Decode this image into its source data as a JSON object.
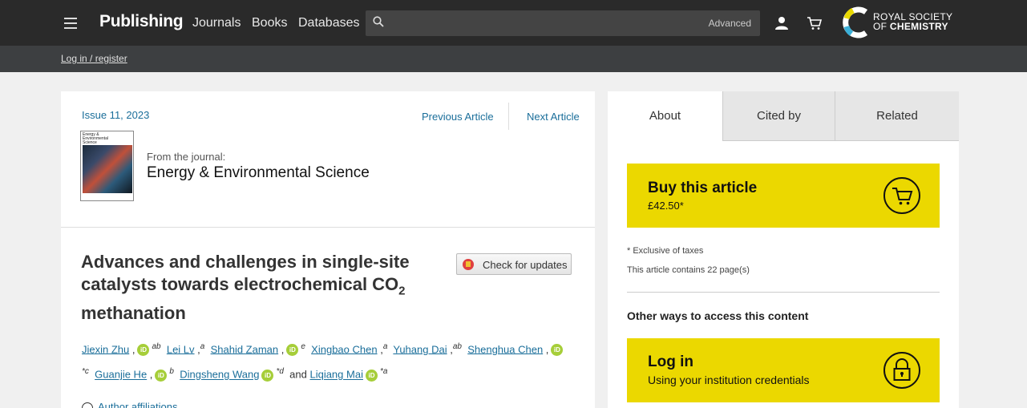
{
  "header": {
    "brand": "Publishing",
    "nav": [
      "Journals",
      "Books",
      "Databases"
    ],
    "search_placeholder": "",
    "advanced_label": "Advanced",
    "logo_line1": "ROYAL SOCIETY",
    "logo_line2_prefix": "OF",
    "logo_line2_bold": "CHEMISTRY"
  },
  "subbar": {
    "login_label": "Log in / register"
  },
  "article_nav": {
    "issue": "Issue 11, 2023",
    "previous": "Previous Article",
    "next": "Next Article"
  },
  "journal": {
    "from_label": "From the journal:",
    "name": "Energy & Environmental Science",
    "cover_title": "Energy & Environmental Science"
  },
  "article": {
    "title_main": "Advances and challenges in single-site catalysts towards electrochemical CO",
    "title_sub": "2",
    "title_end": " methanation",
    "check_updates": "Check for updates",
    "affiliations": "Author affiliations"
  },
  "authors": [
    {
      "name": "Jiexin Zhu",
      "orcid": true,
      "star": "",
      "sup": "ab"
    },
    {
      "name": "Lei Lv",
      "orcid": false,
      "star": "",
      "sup": "a"
    },
    {
      "name": "Shahid Zaman",
      "orcid": true,
      "star": "",
      "sup": "e"
    },
    {
      "name": "Xingbao Chen",
      "orcid": false,
      "star": "",
      "sup": "a"
    },
    {
      "name": "Yuhang Dai",
      "orcid": false,
      "star": "",
      "sup": "ab"
    },
    {
      "name": "Shenghua Chen",
      "orcid": true,
      "star": "*",
      "sup": "c"
    },
    {
      "name": "Guanjie He",
      "orcid": true,
      "star": "",
      "sup": "b"
    },
    {
      "name": "Dingsheng Wang",
      "orcid": true,
      "star": "*",
      "sup": "d"
    },
    {
      "name": "Liqiang Mai",
      "orcid": true,
      "star": "*",
      "sup": "a"
    }
  ],
  "authors_and": "and",
  "orcid_label": "iD",
  "sidebar": {
    "tabs": [
      "About",
      "Cited by",
      "Related"
    ],
    "buy_title": "Buy this article",
    "buy_price": "£42.50*",
    "exclusive": "* Exclusive of taxes",
    "pages": "This article contains 22 page(s)",
    "other_ways": "Other ways to access this content",
    "login_title": "Log in",
    "login_sub": "Using your institution credentials"
  },
  "colors": {
    "accent_yellow": "#ebd800",
    "link_blue": "#1a6e9a",
    "orcid_green": "#a6ce39",
    "topbar": "#2a2a2a"
  }
}
